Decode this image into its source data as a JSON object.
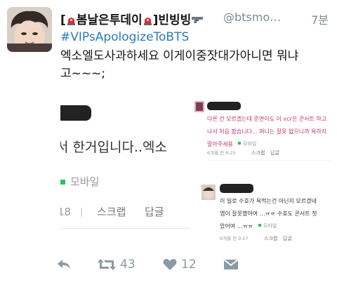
{
  "tweet": {
    "display_name_open": "[",
    "display_name_word": "봄날은투데이",
    "display_name_close": "]빈빙빙",
    "handle": "@btsmo…",
    "time": "7분",
    "hashtag": "#VIPsApologizeToBTS",
    "text": "엑소엘도사과하세요 이게이중잣대가아니면 뭐냐\n고~~~;"
  },
  "image_left": {
    "text_line": "서 한거입니다..엑소",
    "mobile_label": "모바일",
    "meta_num": "18",
    "meta_sep": "|",
    "scrap": "스크랩",
    "reply": "답글",
    "colors": {
      "mobile_dot": "#2ec05a",
      "text": "#333333",
      "meta": "#9a9a9a"
    }
  },
  "image_right": {
    "comment1_lines": [
      "다른 건 모르겠는데 준면이도 이 vcr은 콘서트 하고",
      "나서 처음 봤습니다... 며니는 잘못 없으니까 욕하지",
      "말아주세용"
    ],
    "comment1_mobile": "모바일",
    "comment1_meta": "6개월 전  8:25",
    "comment1_scrap": "스크랩",
    "comment1_reply": "답글",
    "comment2_lines": [
      "이 일로 수호가 욕먹는건 아닌지 모르겠네",
      "엠이 잘못했어여 …ㅠㅠ 수호도 콘서트 첫",
      "았어여 …ㅠㅠ"
    ],
    "comment2_mobile": "모바일",
    "comment2_meta": "6개월 전  9:27",
    "comment2_scrap": "스크랩",
    "comment2_reply": "답글",
    "colors": {
      "pink": "#c0336a",
      "text2": "#333333"
    }
  },
  "actions": {
    "retweet_count": "43",
    "like_count": "12"
  },
  "colors": {
    "link": "#2b7bb9",
    "meta": "#7d8a93",
    "icon": "#8a9aa5"
  }
}
